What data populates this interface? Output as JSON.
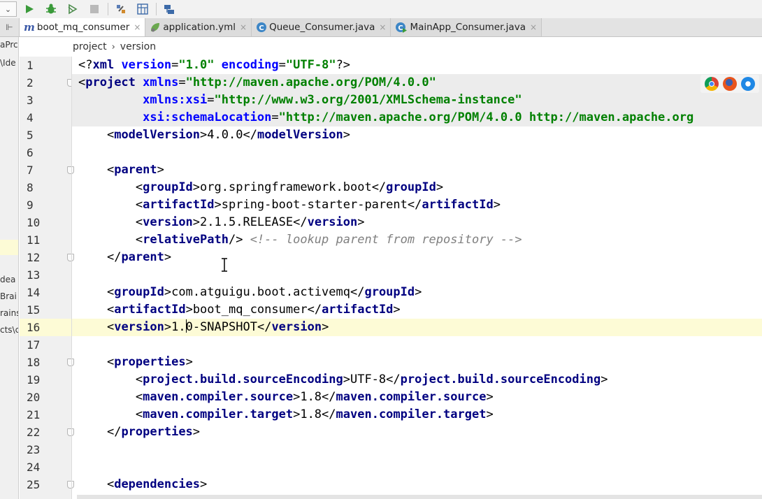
{
  "tabs": [
    {
      "label": "boot_mq_consumer",
      "icon": "maven-m-icon",
      "active": true
    },
    {
      "label": "application.yml",
      "icon": "spring-leaf-icon",
      "active": false
    },
    {
      "label": "Queue_Consumer.java",
      "icon": "class-c-icon",
      "active": false
    },
    {
      "label": "MainApp_Consumer.java",
      "icon": "class-run-icon",
      "active": false
    }
  ],
  "breadcrumb": {
    "items": [
      "project",
      "version"
    ],
    "separator": "›"
  },
  "left_panel_fragments": [
    "aPrc",
    "\\Ide",
    "dea",
    "Brai",
    "rains",
    "cts\\c"
  ],
  "lines": [
    {
      "n": "1",
      "t": [
        [
          "punc",
          "<?"
        ],
        [
          "tag",
          "xml "
        ],
        [
          "attr",
          "version"
        ],
        [
          "punc",
          "="
        ],
        [
          "val",
          "\"1.0\" "
        ],
        [
          "attr",
          "encoding"
        ],
        [
          "punc",
          "="
        ],
        [
          "val",
          "\"UTF-8\""
        ],
        [
          "punc",
          "?>"
        ]
      ]
    },
    {
      "n": "2",
      "t": [
        [
          "punc",
          "<"
        ],
        [
          "tag",
          "project "
        ],
        [
          "attr",
          "xmlns"
        ],
        [
          "punc",
          "="
        ],
        [
          "val",
          "\"http://maven.apache.org/POM/4.0.0\""
        ]
      ]
    },
    {
      "n": "3",
      "t": [
        [
          "text",
          "         "
        ],
        [
          "attr",
          "xmlns:xsi"
        ],
        [
          "punc",
          "="
        ],
        [
          "val",
          "\"http://www.w3.org/2001/XMLSchema-instance\""
        ]
      ]
    },
    {
      "n": "4",
      "t": [
        [
          "text",
          "         "
        ],
        [
          "attr",
          "xsi:schemaLocation"
        ],
        [
          "punc",
          "="
        ],
        [
          "val",
          "\"http://maven.apache.org/POM/4.0.0 http://maven.apache.org"
        ]
      ]
    },
    {
      "n": "5",
      "t": [
        [
          "text",
          "    "
        ],
        [
          "punc",
          "<"
        ],
        [
          "tag",
          "modelVersion"
        ],
        [
          "punc",
          ">"
        ],
        [
          "text",
          "4.0.0"
        ],
        [
          "punc",
          "</"
        ],
        [
          "tag",
          "modelVersion"
        ],
        [
          "punc",
          ">"
        ]
      ]
    },
    {
      "n": "6",
      "t": []
    },
    {
      "n": "7",
      "t": [
        [
          "text",
          "    "
        ],
        [
          "punc",
          "<"
        ],
        [
          "tag",
          "parent"
        ],
        [
          "punc",
          ">"
        ]
      ]
    },
    {
      "n": "8",
      "t": [
        [
          "text",
          "        "
        ],
        [
          "punc",
          "<"
        ],
        [
          "tag",
          "groupId"
        ],
        [
          "punc",
          ">"
        ],
        [
          "text",
          "org.springframework.boot"
        ],
        [
          "punc",
          "</"
        ],
        [
          "tag",
          "groupId"
        ],
        [
          "punc",
          ">"
        ]
      ]
    },
    {
      "n": "9",
      "t": [
        [
          "text",
          "        "
        ],
        [
          "punc",
          "<"
        ],
        [
          "tag",
          "artifactId"
        ],
        [
          "punc",
          ">"
        ],
        [
          "text",
          "spring-boot-starter-parent"
        ],
        [
          "punc",
          "</"
        ],
        [
          "tag",
          "artifactId"
        ],
        [
          "punc",
          ">"
        ]
      ]
    },
    {
      "n": "10",
      "t": [
        [
          "text",
          "        "
        ],
        [
          "punc",
          "<"
        ],
        [
          "tag",
          "version"
        ],
        [
          "punc",
          ">"
        ],
        [
          "text",
          "2.1.5.RELEASE"
        ],
        [
          "punc",
          "</"
        ],
        [
          "tag",
          "version"
        ],
        [
          "punc",
          ">"
        ]
      ]
    },
    {
      "n": "11",
      "t": [
        [
          "text",
          "        "
        ],
        [
          "punc",
          "<"
        ],
        [
          "tag",
          "relativePath"
        ],
        [
          "punc",
          "/> "
        ],
        [
          "comment",
          "<!-- lookup parent from repository -->"
        ]
      ]
    },
    {
      "n": "12",
      "t": [
        [
          "text",
          "    "
        ],
        [
          "punc",
          "</"
        ],
        [
          "tag",
          "parent"
        ],
        [
          "punc",
          ">"
        ]
      ]
    },
    {
      "n": "13",
      "t": []
    },
    {
      "n": "14",
      "t": [
        [
          "text",
          "    "
        ],
        [
          "punc",
          "<"
        ],
        [
          "tag",
          "groupId"
        ],
        [
          "punc",
          ">"
        ],
        [
          "text",
          "com.atguigu.boot.activemq"
        ],
        [
          "punc",
          "</"
        ],
        [
          "tag",
          "groupId"
        ],
        [
          "punc",
          ">"
        ]
      ]
    },
    {
      "n": "15",
      "t": [
        [
          "text",
          "    "
        ],
        [
          "punc",
          "<"
        ],
        [
          "tag",
          "artifactId"
        ],
        [
          "punc",
          ">"
        ],
        [
          "text",
          "boot_mq_consumer"
        ],
        [
          "punc",
          "</"
        ],
        [
          "tag",
          "artifactId"
        ],
        [
          "punc",
          ">"
        ]
      ]
    },
    {
      "n": "16",
      "t": [
        [
          "text",
          "    "
        ],
        [
          "punc",
          "<"
        ],
        [
          "tag",
          "version"
        ],
        [
          "punc",
          ">"
        ],
        [
          "text",
          "1."
        ],
        [
          "caret",
          ""
        ],
        [
          "text",
          "0-SNAPSHOT"
        ],
        [
          "punc",
          "</"
        ],
        [
          "tag",
          "version"
        ],
        [
          "punc",
          ">"
        ]
      ]
    },
    {
      "n": "17",
      "t": []
    },
    {
      "n": "18",
      "t": [
        [
          "text",
          "    "
        ],
        [
          "punc",
          "<"
        ],
        [
          "tag",
          "properties"
        ],
        [
          "punc",
          ">"
        ]
      ]
    },
    {
      "n": "19",
      "t": [
        [
          "text",
          "        "
        ],
        [
          "punc",
          "<"
        ],
        [
          "tag",
          "project.build.sourceEncoding"
        ],
        [
          "punc",
          ">"
        ],
        [
          "text",
          "UTF-8"
        ],
        [
          "punc",
          "</"
        ],
        [
          "tag",
          "project.build.sourceEncoding"
        ],
        [
          "punc",
          ">"
        ]
      ]
    },
    {
      "n": "20",
      "t": [
        [
          "text",
          "        "
        ],
        [
          "punc",
          "<"
        ],
        [
          "tag",
          "maven.compiler.source"
        ],
        [
          "punc",
          ">"
        ],
        [
          "text",
          "1.8"
        ],
        [
          "punc",
          "</"
        ],
        [
          "tag",
          "maven.compiler.source"
        ],
        [
          "punc",
          ">"
        ]
      ]
    },
    {
      "n": "21",
      "t": [
        [
          "text",
          "        "
        ],
        [
          "punc",
          "<"
        ],
        [
          "tag",
          "maven.compiler.target"
        ],
        [
          "punc",
          ">"
        ],
        [
          "text",
          "1.8"
        ],
        [
          "punc",
          "</"
        ],
        [
          "tag",
          "maven.compiler.target"
        ],
        [
          "punc",
          ">"
        ]
      ]
    },
    {
      "n": "22",
      "t": [
        [
          "text",
          "    "
        ],
        [
          "punc",
          "</"
        ],
        [
          "tag",
          "properties"
        ],
        [
          "punc",
          ">"
        ]
      ]
    },
    {
      "n": "23",
      "t": []
    },
    {
      "n": "24",
      "t": []
    },
    {
      "n": "25",
      "t": [
        [
          "text",
          "    "
        ],
        [
          "punc",
          "<"
        ],
        [
          "tag",
          "dependencies"
        ],
        [
          "punc",
          ">"
        ]
      ]
    }
  ],
  "fold_lines": [
    "2",
    "7",
    "12",
    "18",
    "22",
    "25"
  ],
  "tinted_lines": [
    "2",
    "3",
    "4"
  ],
  "current_line": "16",
  "browser_icons": [
    "chrome-icon",
    "firefox-icon",
    "safari-icon"
  ],
  "colors": {
    "tag": "#000080",
    "attr": "#0000ff",
    "value": "#008000",
    "comment": "#808080",
    "current_line": "#fdfbd6"
  }
}
